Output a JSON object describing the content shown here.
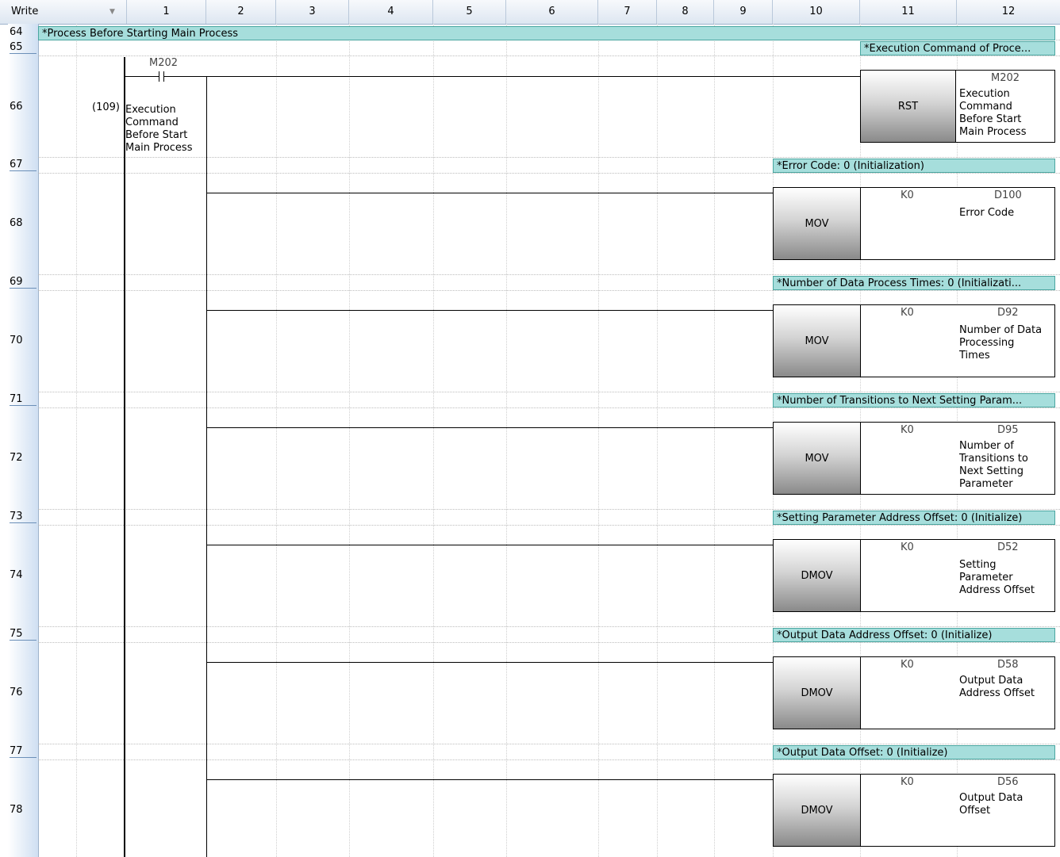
{
  "header": {
    "mode": "Write",
    "columns": [
      "1",
      "2",
      "3",
      "4",
      "5",
      "6",
      "7",
      "8",
      "9",
      "10",
      "11",
      "12"
    ]
  },
  "rows": [
    {
      "num": "64"
    },
    {
      "num": "65"
    },
    {
      "num": "66"
    },
    {
      "num": "67"
    },
    {
      "num": "68"
    },
    {
      "num": "69"
    },
    {
      "num": "70"
    },
    {
      "num": "71"
    },
    {
      "num": "72"
    },
    {
      "num": "73"
    },
    {
      "num": "74"
    },
    {
      "num": "75"
    },
    {
      "num": "76"
    },
    {
      "num": "77"
    },
    {
      "num": "78"
    }
  ],
  "comments": {
    "section": "*Process Before Starting Main Process",
    "c65": "*Execution Command of Proce...",
    "c67": "*Error Code: 0 (Initialization)",
    "c69": "*Number of Data Process Times: 0 (Initializati...",
    "c71": "*Number of Transitions to Next Setting Param...",
    "c73": "*Setting Parameter Address Offset: 0 (Initialize)",
    "c75": "*Output Data Address Offset: 0 (Initialize)",
    "c77": "*Output Data Offset: 0 (Initialize)"
  },
  "contact": {
    "device": "M202",
    "step": "(109)",
    "comment_lines": [
      "Execution",
      "Command",
      "Before Start",
      "Main Process"
    ]
  },
  "instructions": [
    {
      "name": "RST",
      "src": "",
      "dst": "M202",
      "comment_lines": [
        "Execution",
        "Command",
        "Before Start",
        "Main Process"
      ]
    },
    {
      "name": "MOV",
      "src": "K0",
      "dst": "D100",
      "comment_lines": [
        "Error Code"
      ]
    },
    {
      "name": "MOV",
      "src": "K0",
      "dst": "D92",
      "comment_lines": [
        "Number of Data",
        "Processing",
        "Times"
      ]
    },
    {
      "name": "MOV",
      "src": "K0",
      "dst": "D95",
      "comment_lines": [
        "Number of",
        "Transitions to",
        "Next Setting",
        "Parameter"
      ]
    },
    {
      "name": "DMOV",
      "src": "K0",
      "dst": "D52",
      "comment_lines": [
        "Setting",
        "Parameter",
        "Address Offset"
      ]
    },
    {
      "name": "DMOV",
      "src": "K0",
      "dst": "D58",
      "comment_lines": [
        "Output Data",
        "Address Offset"
      ]
    },
    {
      "name": "DMOV",
      "src": "K0",
      "dst": "D56",
      "comment_lines": [
        "Output Data",
        "Offset"
      ]
    }
  ]
}
